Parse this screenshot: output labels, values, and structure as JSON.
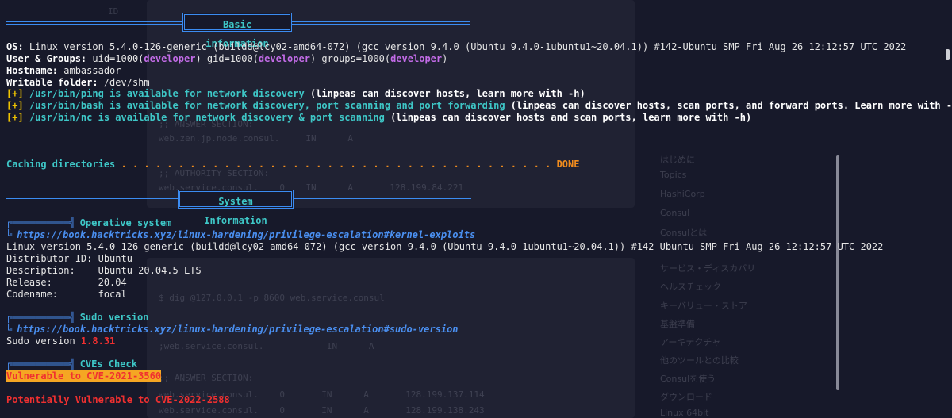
{
  "sections": {
    "basic": "Basic information",
    "system": "System Information"
  },
  "basic": {
    "os_label": "OS:",
    "os_value": " Linux version 5.4.0-126-generic (buildd@lcy02-amd64-072) (gcc version 9.4.0 (Ubuntu 9.4.0-1ubuntu1~20.04.1)) #142-Ubuntu SMP Fri Aug 26 12:12:57 UTC 2022",
    "ug_label": "User & Groups:",
    "ug_uid": " uid=1000(",
    "ug_user": "developer",
    "ug_gid": ") gid=1000(",
    "ug_groups": ") groups=1000(",
    "ug_close": ")",
    "host_label": "Hostname:",
    "host_value": " ambassador",
    "wf_label": "Writable folder:",
    "wf_value": " /dev/shm",
    "plus": "[+]",
    "ping_path": " /usr/bin/ping",
    "ping_mid": " is available for network discovery",
    "ping_tail": " (linpeas can discover hosts, learn more with -h)",
    "bash_path": " /usr/bin/bash",
    "bash_mid": " is available for network discovery, port scanning and port forwarding",
    "bash_tail": " (linpeas can discover hosts, scan ports, and forward ports. Learn more with -h)",
    "nc_path": " /usr/bin/nc",
    "nc_mid": " is available for network discovery & port scanning",
    "nc_tail": " (linpeas can discover hosts and scan ports, learn more with -h)"
  },
  "caching": {
    "label": "Caching directories",
    "dots": " . . . . . . . . . . . . . . . . . . . . . . . . . . . . . . . . . . . . . . ",
    "done": "DONE"
  },
  "system": {
    "operative_title": "Operative system",
    "operative_link": "https://book.hacktricks.xyz/linux-hardening/privilege-escalation#kernel-exploits",
    "kernel_line": "Linux version 5.4.0-126-generic (buildd@lcy02-amd64-072) (gcc version 9.4.0 (Ubuntu 9.4.0-1ubuntu1~20.04.1)) #142-Ubuntu SMP Fri Aug 26 12:12:57 UTC 2022",
    "distributor": "Distributor ID: Ubuntu",
    "description": "Description:    Ubuntu 20.04.5 LTS",
    "release": "Release:        20.04",
    "codename": "Codename:       focal",
    "sudo_title": "Sudo version",
    "sudo_link": "https://book.hacktricks.xyz/linux-hardening/privilege-escalation#sudo-version",
    "sudo_label": "Sudo version ",
    "sudo_value": "1.8.31",
    "cves_title": "CVEs Check",
    "cve1": "Vulnerable to CVE-2021-3560",
    "cve2": "Potentially Vulnerable to CVE-2022-2588"
  },
  "tree": {
    "branch_top": "╔══════════╣",
    "branch_bottom": "╚"
  },
  "ghost": {
    "lines_top": [
      "ID",
      "S dig @127.0.0.1 -p 8600 web.service.consul"
    ],
    "answer": ";; ANSWER SECTION:",
    "rec1": "web.zen.jp.node.consul.     IN      A",
    "authority": ";; AUTHORITY SECTION:",
    "rec2": "web.service.consul.    0    IN      A       128.199.84.221",
    "cmd2": "$ dig @127.0.0.1 -p 8600 web.service.consul",
    "question": ";web.service.consul.            IN      A",
    "answer2": ";; ANSWER SECTION:",
    "rec3": "web.service.consul.    0       IN      A       128.199.137.114",
    "rec4": "web.service.consul.    0       IN      A       128.199.138.243",
    "side": [
      "はじめに",
      "Topics",
      "HashiCorp",
      "Consul",
      "Consulとは",
      "サービス・ディスカバリ",
      "ヘルスチェック",
      "キーバリュー・ストア",
      "基盤準備",
      "アーキテクチャ",
      "他のツールとの比較",
      "Consulを使う",
      "ダウンロード",
      "Linux 64bit"
    ]
  }
}
